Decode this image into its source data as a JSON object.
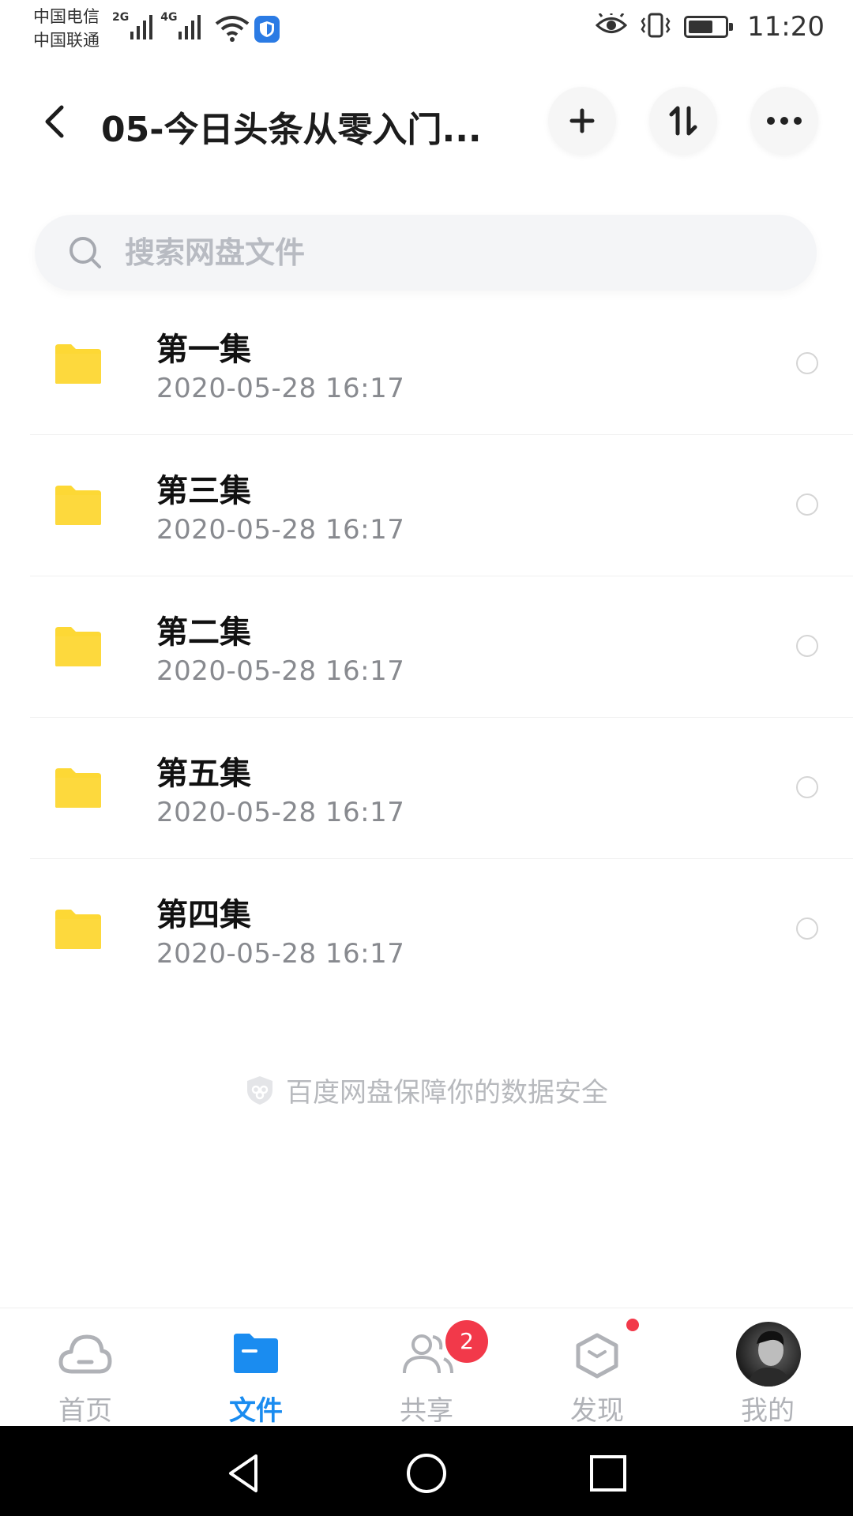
{
  "status_bar": {
    "carrier_1": "中国电信",
    "carrier_2": "中国联通",
    "net_1": "2G",
    "net_2": "4G",
    "time": "11:20"
  },
  "header": {
    "title": "05-今日头条从零入门...",
    "back_icon": "chevron-left-icon",
    "add_icon": "plus-icon",
    "sort_icon": "transfer-sort-icon",
    "more_icon": "more-dots-icon"
  },
  "search": {
    "placeholder": "搜索网盘文件",
    "value": ""
  },
  "files": [
    {
      "name": "第一集",
      "date": "2020-05-28  16:17"
    },
    {
      "name": "第三集",
      "date": "2020-05-28  16:17"
    },
    {
      "name": "第二集",
      "date": "2020-05-28  16:17"
    },
    {
      "name": "第五集",
      "date": "2020-05-28  16:17"
    },
    {
      "name": "第四集",
      "date": "2020-05-28  16:17"
    }
  ],
  "footer_note": "百度网盘保障你的数据安全",
  "tabs": [
    {
      "label": "首页",
      "icon": "cloud-icon"
    },
    {
      "label": "文件",
      "icon": "folder-icon",
      "active": true
    },
    {
      "label": "共享",
      "icon": "users-icon",
      "badge": "2"
    },
    {
      "label": "发现",
      "icon": "discover-icon",
      "dot": true
    },
    {
      "label": "我的",
      "icon": "avatar"
    }
  ],
  "colors": {
    "accent": "#1a8cf0",
    "folder": "#fdd835",
    "badge": "#f2394a"
  }
}
